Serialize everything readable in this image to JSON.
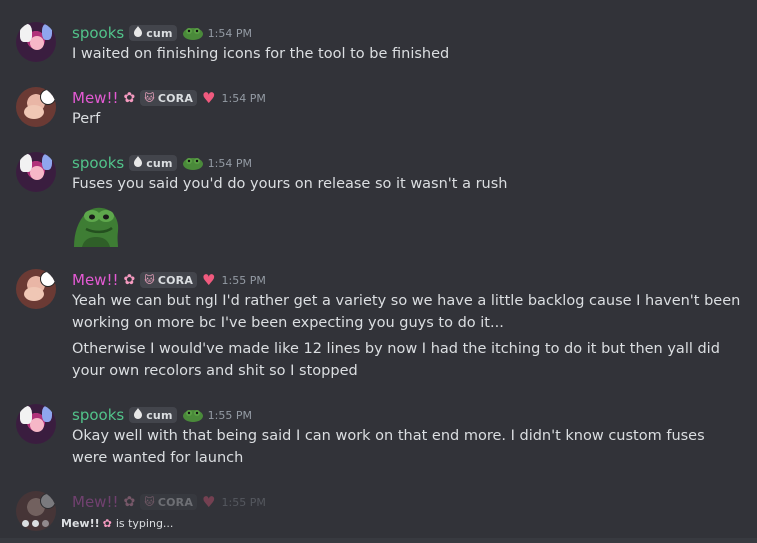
{
  "messages": [
    {
      "author": "spooks",
      "tag": "cum",
      "timestamp": "1:54 PM",
      "lines": [
        "I waited on finishing icons for the tool to be finished"
      ]
    },
    {
      "author": "Mew!!",
      "tag": "CORA",
      "timestamp": "1:54 PM",
      "lines": [
        "Perf"
      ]
    },
    {
      "author": "spooks",
      "tag": "cum",
      "timestamp": "1:54 PM",
      "lines": [
        "Fuses you said you'd do yours on release so it wasn't a rush"
      ]
    },
    {
      "author": "Mew!!",
      "tag": "CORA",
      "timestamp": "1:55 PM",
      "lines": [
        "Yeah we can but ngl I'd rather get a variety so we have a little backlog cause I haven't been working on more bc I've been expecting you guys to do it...",
        "Otherwise I would've made like 12 lines by now I had the itching to do it but then yall did your own recolors and shit so I stopped"
      ]
    },
    {
      "author": "spooks",
      "tag": "cum",
      "timestamp": "1:55 PM",
      "lines": [
        "Okay well with that being said I can work on that end more. I didn't know custom fuses were wanted for launch"
      ]
    },
    {
      "author": "Mew!!",
      "tag": "CORA",
      "timestamp": "1:55 PM",
      "lines": []
    }
  ],
  "typing": {
    "name": "Mew!!",
    "suffix": "is typing..."
  },
  "colors": {
    "background": "#323339",
    "spooks_name": "#52c38a",
    "mew_name": "#e35ad3",
    "text": "#dbdee1",
    "timestamp": "#949ba4"
  },
  "icons": {
    "spooks_tag": "garlic-icon",
    "spooks_role": "pepe-frog-icon",
    "mew_role": "heart-icon",
    "mew_name_flower": "pink-flower-icon",
    "mew_tag": "cat-face-icon"
  }
}
